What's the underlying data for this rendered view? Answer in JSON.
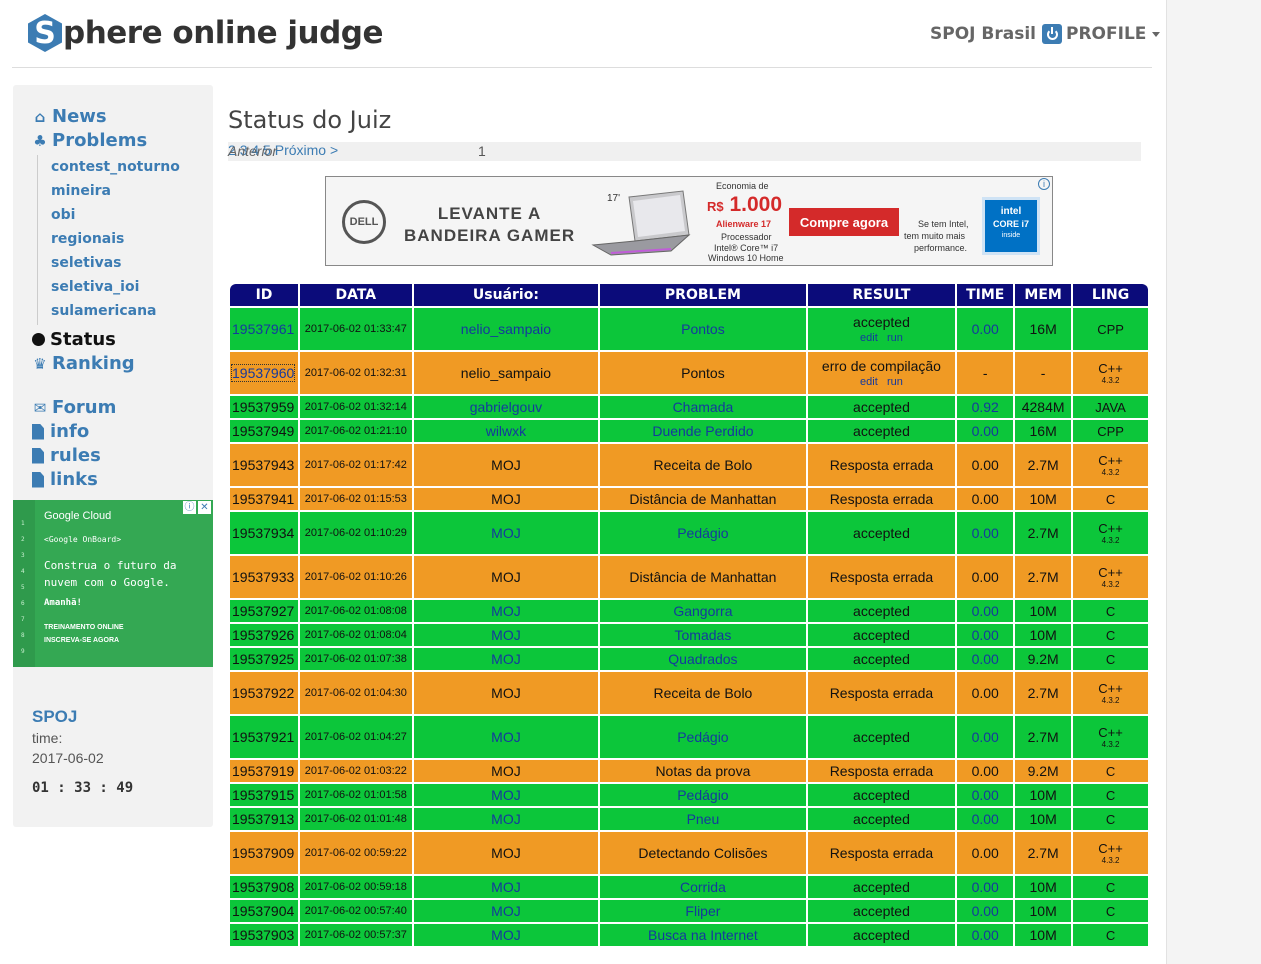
{
  "header": {
    "logo_letter": "S",
    "logo_text": "phere online judge",
    "spoj_brasil": "SPOJ Brasil",
    "profile": "PROFILE"
  },
  "sidebar": {
    "news": "News",
    "problems": "Problems",
    "sub_items": [
      "contest_noturno",
      "mineira",
      "obi",
      "regionais",
      "seletivas",
      "seletiva_ioi",
      "sulamericana"
    ],
    "status": "Status",
    "ranking": "Ranking",
    "forum": "Forum",
    "info": "info",
    "rules": "rules",
    "links": "links",
    "ad": {
      "brand": "Google Cloud",
      "code": "<Google OnBoard>",
      "line1": "Construa o futuro da",
      "line2": "nuvem com o Google.",
      "line3": "Amanhã!",
      "cta1": "TREINAMENTO ONLINE",
      "cta2": "INSCREVA-SE AGORA"
    },
    "clock": {
      "title": "SPOJ",
      "time_label": "time:",
      "date": "2017-06-02",
      "time": "01 : 33 : 49"
    }
  },
  "main": {
    "title": "Status do Juiz",
    "pager": {
      "prev": "Anterior",
      "pages": [
        "1",
        "2",
        "3",
        "4",
        "5"
      ],
      "next": "Próximo >"
    },
    "ad": {
      "logo": "DELL",
      "headline1": "LEVANTE A",
      "headline2": "BANDEIRA GAMER",
      "size": "17'",
      "economia": "Economia de",
      "currency": "R$",
      "price": "1.000",
      "model": "Alienware 17",
      "spec1": "Processador",
      "spec2": "Intel® Core™ i7",
      "spec3": "Windows 10 Home",
      "cta": "Compre agora",
      "intel1": "Se tem Intel,",
      "intel2": "tem muito mais",
      "intel3": "performance.",
      "intel_badge1": "intel",
      "intel_badge2": "CORE i7",
      "intel_badge3": "inside"
    },
    "table": {
      "headers": [
        "ID",
        "DATA",
        "Usuário:",
        "PROBLEM",
        "RESULT",
        "TIME",
        "MEM",
        "LING"
      ],
      "edit": "edit",
      "run": "run",
      "rows": [
        {
          "id": "19537961",
          "date": "2017-06-02 01:33:47",
          "user": "nelio_sampaio",
          "problem": "Pontos",
          "result": "accepted",
          "time": "0.00",
          "mem": "16M",
          "lang": "CPP",
          "lang_ver": "",
          "status": "acc",
          "actions": true
        },
        {
          "id": "19537960",
          "date": "2017-06-02 01:32:31",
          "user": "nelio_sampaio",
          "problem": "Pontos",
          "result": "erro de compilação",
          "time": "-",
          "mem": "-",
          "lang": "C++",
          "lang_ver": "4.3.2",
          "status": "err",
          "actions": true
        },
        {
          "id": "19537959",
          "date": "2017-06-02 01:32:14",
          "user": "gabrielgouv",
          "problem": "Chamada",
          "result": "accepted",
          "time": "0.92",
          "mem": "4284M",
          "lang": "JAVA",
          "lang_ver": "",
          "status": "acc",
          "actions": false
        },
        {
          "id": "19537949",
          "date": "2017-06-02 01:21:10",
          "user": "wilwxk",
          "problem": "Duende Perdido",
          "result": "accepted",
          "time": "0.00",
          "mem": "16M",
          "lang": "CPP",
          "lang_ver": "",
          "status": "acc",
          "actions": false
        },
        {
          "id": "19537943",
          "date": "2017-06-02 01:17:42",
          "user": "MOJ",
          "problem": "Receita de Bolo",
          "result": "Resposta errada",
          "time": "0.00",
          "mem": "2.7M",
          "lang": "C++",
          "lang_ver": "4.3.2",
          "status": "err",
          "actions": false
        },
        {
          "id": "19537941",
          "date": "2017-06-02 01:15:53",
          "user": "MOJ",
          "problem": "Distância de Manhattan",
          "result": "Resposta errada",
          "time": "0.00",
          "mem": "10M",
          "lang": "C",
          "lang_ver": "",
          "status": "err",
          "actions": false
        },
        {
          "id": "19537934",
          "date": "2017-06-02 01:10:29",
          "user": "MOJ",
          "problem": "Pedágio",
          "result": "accepted",
          "time": "0.00",
          "mem": "2.7M",
          "lang": "C++",
          "lang_ver": "4.3.2",
          "status": "acc",
          "actions": false
        },
        {
          "id": "19537933",
          "date": "2017-06-02 01:10:26",
          "user": "MOJ",
          "problem": "Distância de Manhattan",
          "result": "Resposta errada",
          "time": "0.00",
          "mem": "2.7M",
          "lang": "C++",
          "lang_ver": "4.3.2",
          "status": "err",
          "actions": false
        },
        {
          "id": "19537927",
          "date": "2017-06-02 01:08:08",
          "user": "MOJ",
          "problem": "Gangorra",
          "result": "accepted",
          "time": "0.00",
          "mem": "10M",
          "lang": "C",
          "lang_ver": "",
          "status": "acc",
          "actions": false
        },
        {
          "id": "19537926",
          "date": "2017-06-02 01:08:04",
          "user": "MOJ",
          "problem": "Tomadas",
          "result": "accepted",
          "time": "0.00",
          "mem": "10M",
          "lang": "C",
          "lang_ver": "",
          "status": "acc",
          "actions": false
        },
        {
          "id": "19537925",
          "date": "2017-06-02 01:07:38",
          "user": "MOJ",
          "problem": "Quadrados",
          "result": "accepted",
          "time": "0.00",
          "mem": "9.2M",
          "lang": "C",
          "lang_ver": "",
          "status": "acc",
          "actions": false
        },
        {
          "id": "19537922",
          "date": "2017-06-02 01:04:30",
          "user": "MOJ",
          "problem": "Receita de Bolo",
          "result": "Resposta errada",
          "time": "0.00",
          "mem": "2.7M",
          "lang": "C++",
          "lang_ver": "4.3.2",
          "status": "err",
          "actions": false
        },
        {
          "id": "19537921",
          "date": "2017-06-02 01:04:27",
          "user": "MOJ",
          "problem": "Pedágio",
          "result": "accepted",
          "time": "0.00",
          "mem": "2.7M",
          "lang": "C++",
          "lang_ver": "4.3.2",
          "status": "acc",
          "actions": false
        },
        {
          "id": "19537919",
          "date": "2017-06-02 01:03:22",
          "user": "MOJ",
          "problem": "Notas da prova",
          "result": "Resposta errada",
          "time": "0.00",
          "mem": "9.2M",
          "lang": "C",
          "lang_ver": "",
          "status": "err",
          "actions": false
        },
        {
          "id": "19537915",
          "date": "2017-06-02 01:01:58",
          "user": "MOJ",
          "problem": "Pedágio",
          "result": "accepted",
          "time": "0.00",
          "mem": "10M",
          "lang": "C",
          "lang_ver": "",
          "status": "acc",
          "actions": false
        },
        {
          "id": "19537913",
          "date": "2017-06-02 01:01:48",
          "user": "MOJ",
          "problem": "Pneu",
          "result": "accepted",
          "time": "0.00",
          "mem": "10M",
          "lang": "C",
          "lang_ver": "",
          "status": "acc",
          "actions": false
        },
        {
          "id": "19537909",
          "date": "2017-06-02 00:59:22",
          "user": "MOJ",
          "problem": "Detectando Colisões",
          "result": "Resposta errada",
          "time": "0.00",
          "mem": "2.7M",
          "lang": "C++",
          "lang_ver": "4.3.2",
          "status": "err",
          "actions": false
        },
        {
          "id": "19537908",
          "date": "2017-06-02 00:59:18",
          "user": "MOJ",
          "problem": "Corrida",
          "result": "accepted",
          "time": "0.00",
          "mem": "10M",
          "lang": "C",
          "lang_ver": "",
          "status": "acc",
          "actions": false
        },
        {
          "id": "19537904",
          "date": "2017-06-02 00:57:40",
          "user": "MOJ",
          "problem": "Fliper",
          "result": "accepted",
          "time": "0.00",
          "mem": "10M",
          "lang": "C",
          "lang_ver": "",
          "status": "acc",
          "actions": false
        },
        {
          "id": "19537903",
          "date": "2017-06-02 00:57:37",
          "user": "MOJ",
          "problem": "Busca na Internet",
          "result": "accepted",
          "time": "0.00",
          "mem": "10M",
          "lang": "C",
          "lang_ver": "",
          "status": "acc",
          "actions": false
        }
      ]
    }
  },
  "colors": {
    "accepted": "#0cc63a",
    "error": "#f09a24",
    "header": "#0b0b7a",
    "link": "#3c7cb3"
  }
}
